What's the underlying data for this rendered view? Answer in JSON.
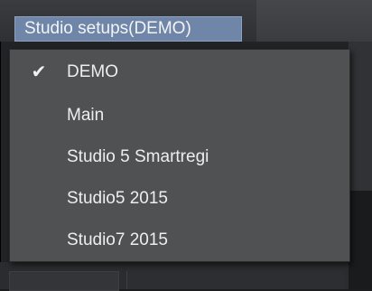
{
  "header": {
    "studio_button_label": "Studio setups(DEMO)"
  },
  "menu": {
    "items": [
      {
        "label": "DEMO",
        "checked": true
      },
      {
        "label": "Main",
        "checked": false
      },
      {
        "label": "Studio 5 Smartregi",
        "checked": false
      },
      {
        "label": "Studio5 2015",
        "checked": false
      },
      {
        "label": "Studio7 2015",
        "checked": false
      }
    ],
    "check_icon": "checkmark-icon"
  }
}
